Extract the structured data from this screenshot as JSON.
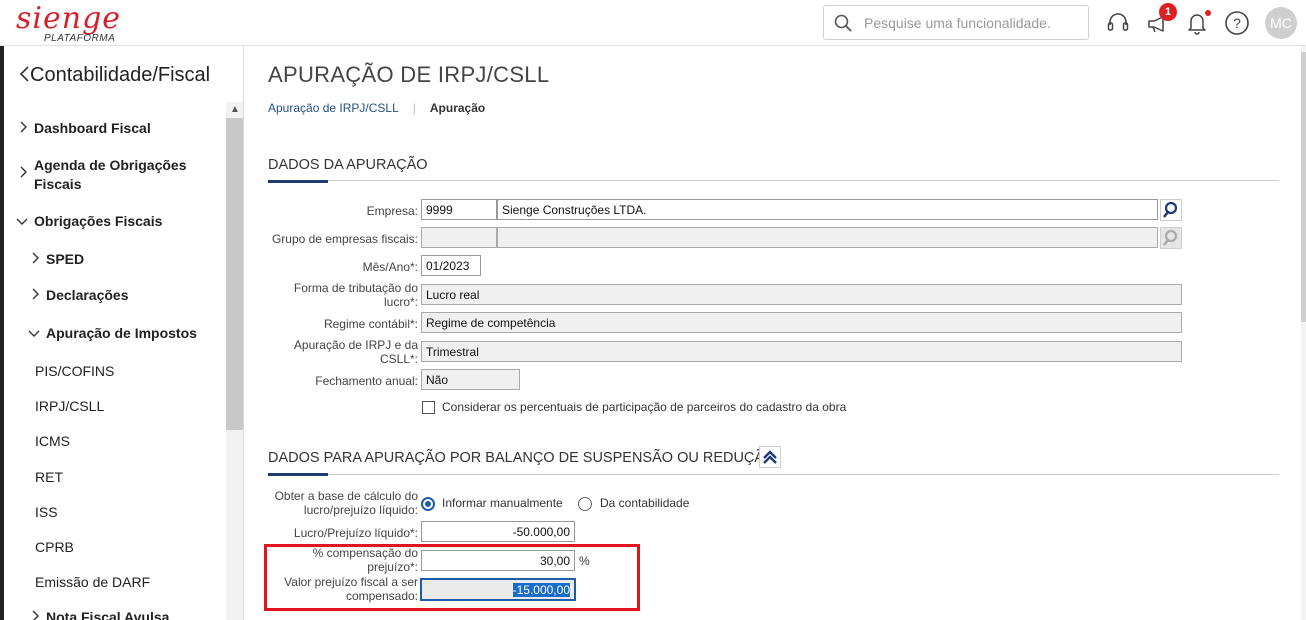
{
  "brand": {
    "name": "sienge",
    "subtitle": "PLATAFORMA",
    "color": "#d5202a"
  },
  "search": {
    "placeholder": "Pesquise uma funcionalidade."
  },
  "topbar": {
    "notification_count": "1",
    "user_initials": "MC"
  },
  "sidebar": {
    "title": "Contabilidade/Fiscal",
    "items": [
      {
        "label": "Dashboard Fiscal",
        "state": "collapsed"
      },
      {
        "label": "Agenda de Obrigações Fiscais",
        "state": "collapsed"
      },
      {
        "label": "Obrigações Fiscais",
        "state": "expanded"
      },
      {
        "label": "SPED",
        "state": "collapsed"
      },
      {
        "label": "Declarações",
        "state": "collapsed"
      },
      {
        "label": "Apuração de Impostos",
        "state": "expanded"
      },
      {
        "label": "PIS/COFINS"
      },
      {
        "label": "IRPJ/CSLL"
      },
      {
        "label": "ICMS"
      },
      {
        "label": "RET"
      },
      {
        "label": "ISS"
      },
      {
        "label": "CPRB"
      },
      {
        "label": "Emissão de DARF"
      },
      {
        "label": "Nota Fiscal Avulsa",
        "state": "collapsed"
      }
    ]
  },
  "page": {
    "title": "APURAÇÃO DE IRPJ/CSLL",
    "breadcrumb": [
      "Apuração de IRPJ/CSLL",
      "Apuração"
    ]
  },
  "dados_apuracao": {
    "heading": "DADOS DA APURAÇÃO",
    "empresa": {
      "label": "Empresa:",
      "code": "9999",
      "name": "Sienge Construções LTDA."
    },
    "grupo": {
      "label": "Grupo de empresas fiscais:",
      "code": "",
      "name": ""
    },
    "mes_ano": {
      "label": "Mês/Ano*:",
      "value": "01/2023"
    },
    "forma_tributacao": {
      "label_line1": "Forma de tributação do",
      "label_line2": "lucro*:",
      "value": "Lucro real"
    },
    "regime": {
      "label": "Regime contábil*:",
      "value": "Regime de competência"
    },
    "apuracao_irpj": {
      "label_line1": "Apuração de IRPJ e da",
      "label_line2": "CSLL*:",
      "value": "Trimestral"
    },
    "fechamento": {
      "label": "Fechamento anual:",
      "value": "Não"
    },
    "considerar": {
      "label": "Considerar os percentuais de participação de parceiros do cadastro da obra",
      "checked": false
    }
  },
  "balanco": {
    "heading": "DADOS PARA APURAÇÃO POR BALANÇO DE SUSPENSÃO OU REDUÇÃO",
    "base_calculo": {
      "label_line1": "Obter a base de cálculo do",
      "label_line2": "lucro/prejuízo líquido:",
      "options": [
        "Informar manualmente",
        "Da contabilidade"
      ],
      "selected": "Informar manualmente"
    },
    "lucro_prejuizo": {
      "label": "Lucro/Prejuízo líquido*:",
      "value": "-50.000,00"
    },
    "compensacao": {
      "label_line1": "% compensação do",
      "label_line2": "prejuízo*:",
      "value": "30,00",
      "unit": "%"
    },
    "valor_prejuizo": {
      "label_line1": "Valor prejuízo fiscal a ser",
      "label_line2": "compensado:",
      "value": "-15.000,00"
    }
  },
  "colors": {
    "accent": "#1e3c72",
    "link": "#1e4f8c",
    "highlight": "#e0141c",
    "selection": "#1a6bd0"
  }
}
